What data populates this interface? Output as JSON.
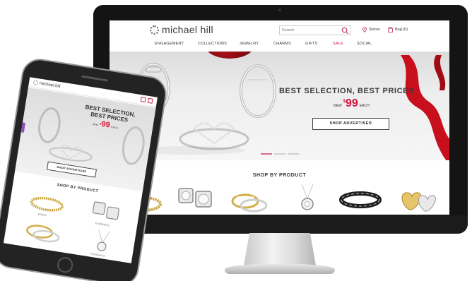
{
  "site": {
    "brand": "michael hill",
    "search_placeholder": "Search",
    "stores_label": "Stores",
    "bag_label": "Bag (0)"
  },
  "nav": {
    "items": [
      {
        "label": "ENGAGEMENT"
      },
      {
        "label": "COLLECTIONS"
      },
      {
        "label": "JEWELRY"
      },
      {
        "label": "CHARMS"
      },
      {
        "label": "GIFTS"
      },
      {
        "label": "SALE"
      },
      {
        "label": "SOCIAL"
      }
    ]
  },
  "hero": {
    "title": "BEST SELECTION, BEST PRICES",
    "price_prefix": "NEW",
    "price_currency": "$",
    "price_value": "99",
    "price_suffix": "EACH",
    "cta": "SHOP ADVERTISED",
    "slides": 3,
    "active_slide": 1
  },
  "shop": {
    "title": "SHOP BY PRODUCT",
    "products": [
      {
        "icon": "gold-bead-ring-icon"
      },
      {
        "icon": "diamond-stud-earrings-icon"
      },
      {
        "icon": "wedding-ring-set-icon"
      },
      {
        "icon": "diamond-pendant-icon"
      },
      {
        "icon": "black-link-bracelet-icon"
      },
      {
        "icon": "heart-earrings-icon"
      }
    ]
  },
  "mobile": {
    "brand": "michael hill",
    "title": "BEST SELECTION, BEST PRICES",
    "price_prefix": "NEW",
    "price_currency": "$",
    "price_value": "99",
    "price_suffix": "EACH",
    "cta": "SHOP ADVERTISED",
    "shop_title": "SHOP BY PRODUCT",
    "product_labels": [
      "RINGS",
      "EARRINGS",
      "PENDANTS"
    ]
  },
  "colors": {
    "accent": "#d0143d",
    "frame": "#141414",
    "text": "#333333",
    "carousel_active": "#d66d8a"
  }
}
